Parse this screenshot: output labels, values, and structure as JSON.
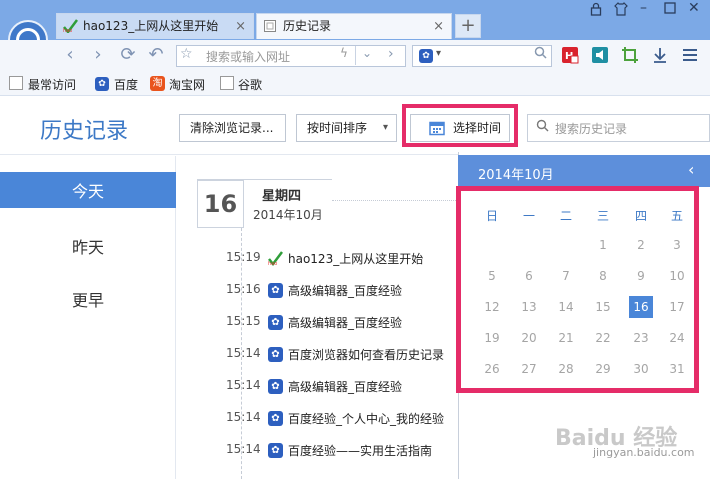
{
  "tabs": [
    {
      "label": "hao123_上网从这里开始",
      "close": "×"
    },
    {
      "label": "历史记录",
      "close": "×"
    }
  ],
  "new_tab": "+",
  "nav": {
    "back": "‹",
    "forward": "›",
    "refresh": "⟳",
    "undo": "↶"
  },
  "address": {
    "placeholder": "搜索或输入网址",
    "star": "☆",
    "bolt": "ϟ",
    "caret": "⌄",
    "go": "›"
  },
  "search_engine": {
    "icon": "paw-icon",
    "caret": "▾"
  },
  "bookmarks": [
    {
      "label": "最常访问"
    },
    {
      "label": "百度"
    },
    {
      "label": "淘宝网"
    },
    {
      "label": "谷歌"
    }
  ],
  "history": {
    "title": "历史记录",
    "clear_button": "清除浏览记录...",
    "sort_button": "按时间排序",
    "sort_caret": "▾",
    "choose_time_button": "选择时间",
    "search_placeholder": "搜索历史记录"
  },
  "sidebar": {
    "items": [
      {
        "label": "今天"
      },
      {
        "label": "昨天"
      },
      {
        "label": "更早"
      }
    ]
  },
  "day": {
    "date": "16",
    "weekday": "星期四",
    "month": "2014年10月"
  },
  "entries": [
    {
      "time": "15:19",
      "title": "hao123_上网从这里开始",
      "icon": "hao123-icon"
    },
    {
      "time": "15:16",
      "title": "高级编辑器_百度经验",
      "icon": "paw-icon"
    },
    {
      "time": "15:15",
      "title": "高级编辑器_百度经验",
      "icon": "paw-icon"
    },
    {
      "time": "15:14",
      "title": "百度浏览器如何查看历史记录",
      "icon": "paw-icon"
    },
    {
      "time": "15:14",
      "title": "高级编辑器_百度经验",
      "icon": "paw-icon"
    },
    {
      "time": "15:14",
      "title": "百度经验_个人中心_我的经验",
      "icon": "paw-icon"
    },
    {
      "time": "15:14",
      "title": "百度经验——实用生活指南",
      "icon": "paw-icon"
    }
  ],
  "calendar": {
    "title": "2014年10月",
    "prev": "‹",
    "weekdays": [
      "日",
      "一",
      "二",
      "三",
      "四",
      "五"
    ],
    "rows": [
      [
        "",
        "",
        "",
        "1",
        "2",
        "3"
      ],
      [
        "5",
        "6",
        "7",
        "8",
        "9",
        "10"
      ],
      [
        "12",
        "13",
        "14",
        "15",
        "16",
        "17"
      ],
      [
        "19",
        "20",
        "21",
        "22",
        "23",
        "24"
      ],
      [
        "26",
        "27",
        "28",
        "29",
        "30",
        "31"
      ]
    ],
    "selected": "16"
  },
  "watermark": {
    "brand": "Baidu 经验",
    "sub": "jingyan.baidu.com"
  },
  "colors": {
    "accent": "#4a86d8",
    "highlight": "#e52c68",
    "tabbar": "#7ca9e6"
  }
}
